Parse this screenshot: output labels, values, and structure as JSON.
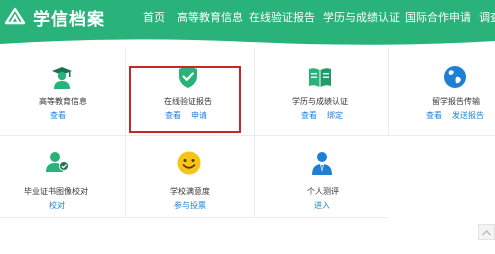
{
  "brand": {
    "name": "学信档案",
    "icon": "chsi-logo-icon",
    "color": "#2ab27b"
  },
  "nav": {
    "items": [
      "首页",
      "高等教育信息",
      "在线验证报告",
      "学历与成绩认证",
      "国际合作申请",
      "调查"
    ]
  },
  "tiles": [
    {
      "title": "高等教育信息",
      "icon": "graduate-icon",
      "links": [
        "查看"
      ]
    },
    {
      "title": "在线验证报告",
      "icon": "verified-shield-icon",
      "links": [
        "查看",
        "申请"
      ]
    },
    {
      "title": "学历与成绩认证",
      "icon": "certificate-book-icon",
      "links": [
        "查看",
        "绑定"
      ]
    },
    {
      "title": "留学报告传输",
      "icon": "globe-icon",
      "links": [
        "查看",
        "发送报告"
      ]
    },
    {
      "title": "毕业证书图像校对",
      "icon": "photo-check-icon",
      "links": [
        "校对"
      ]
    },
    {
      "title": "学校满意度",
      "icon": "smiley-icon",
      "links": [
        "参与投票"
      ]
    },
    {
      "title": "个人测评",
      "icon": "person-assessment-icon",
      "links": [
        "进入"
      ]
    }
  ],
  "colors": {
    "link": "#1f7fd4",
    "highlight": "#c62828"
  }
}
